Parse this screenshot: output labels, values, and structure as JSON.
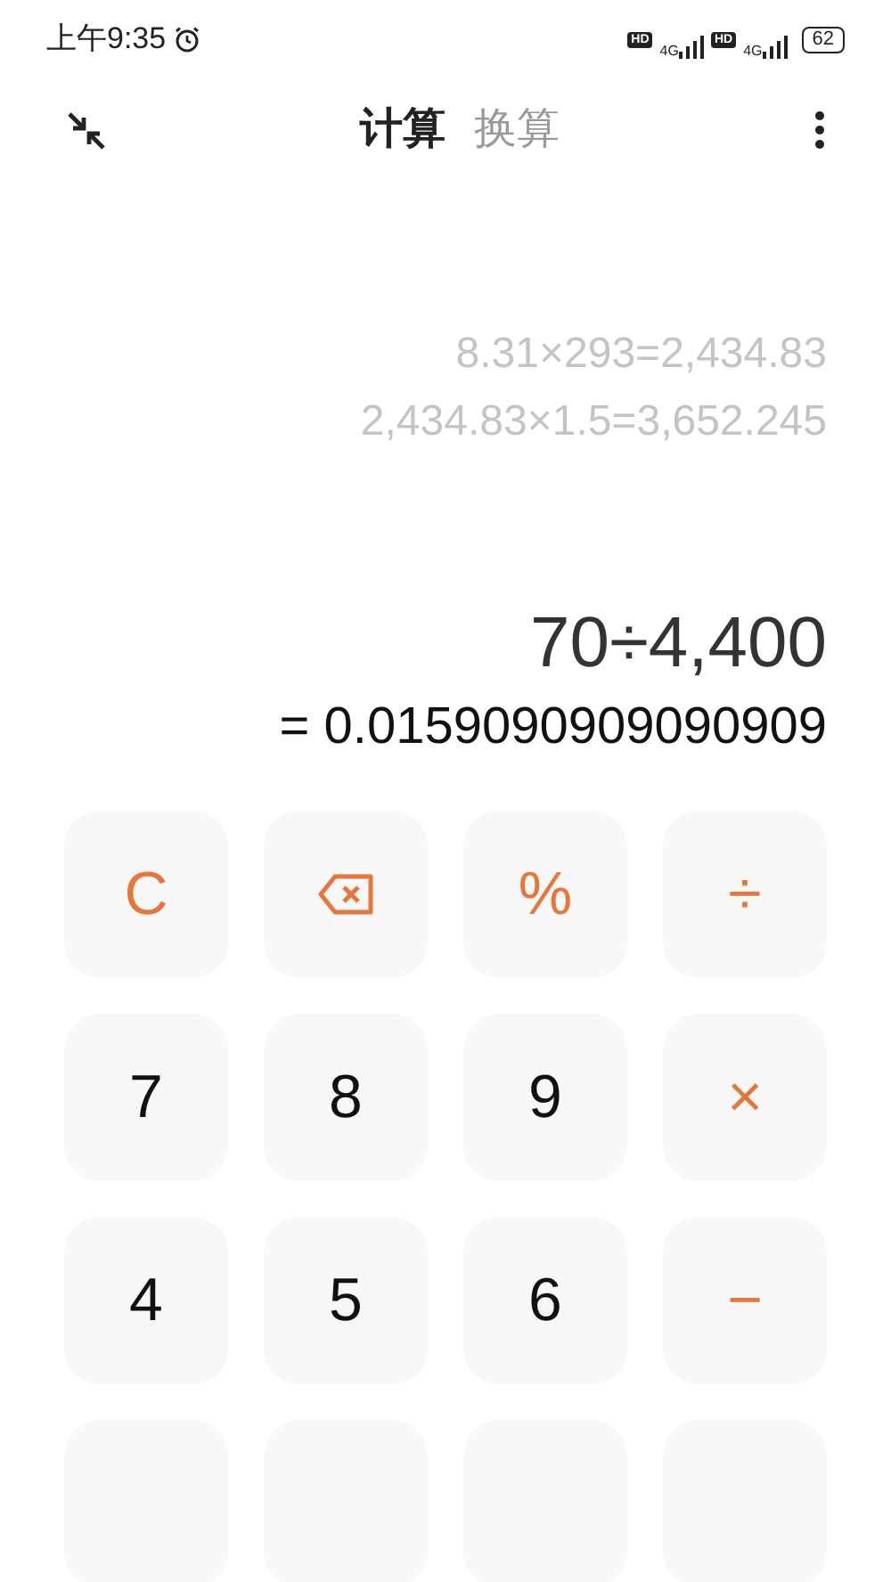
{
  "status_bar": {
    "time": "上午9:35",
    "signals": [
      {
        "badge": "HD",
        "network": "4G"
      },
      {
        "badge": "HD",
        "network": "4G"
      }
    ],
    "battery": "62"
  },
  "tabs": [
    {
      "label": "计算",
      "selected": true
    },
    {
      "label": "换算",
      "selected": false
    }
  ],
  "history": [
    "8.31×293=2,434.83",
    "2,434.83×1.5=3,652.245"
  ],
  "expression": "70÷4,400",
  "result": "= 0.0159090909090909",
  "keys": [
    {
      "kind": "operator",
      "label": "C"
    },
    {
      "kind": "backspace"
    },
    {
      "kind": "operator",
      "label": "%"
    },
    {
      "kind": "operator",
      "label": "÷"
    },
    {
      "kind": "digit",
      "label": "7"
    },
    {
      "kind": "digit",
      "label": "8"
    },
    {
      "kind": "digit",
      "label": "9"
    },
    {
      "kind": "operator",
      "label": "×"
    },
    {
      "kind": "digit",
      "label": "4"
    },
    {
      "kind": "digit",
      "label": "5"
    },
    {
      "kind": "digit",
      "label": "6"
    },
    {
      "kind": "operator",
      "label": "−"
    },
    {
      "kind": "blank"
    },
    {
      "kind": "blank"
    },
    {
      "kind": "blank"
    },
    {
      "kind": "blank"
    }
  ]
}
